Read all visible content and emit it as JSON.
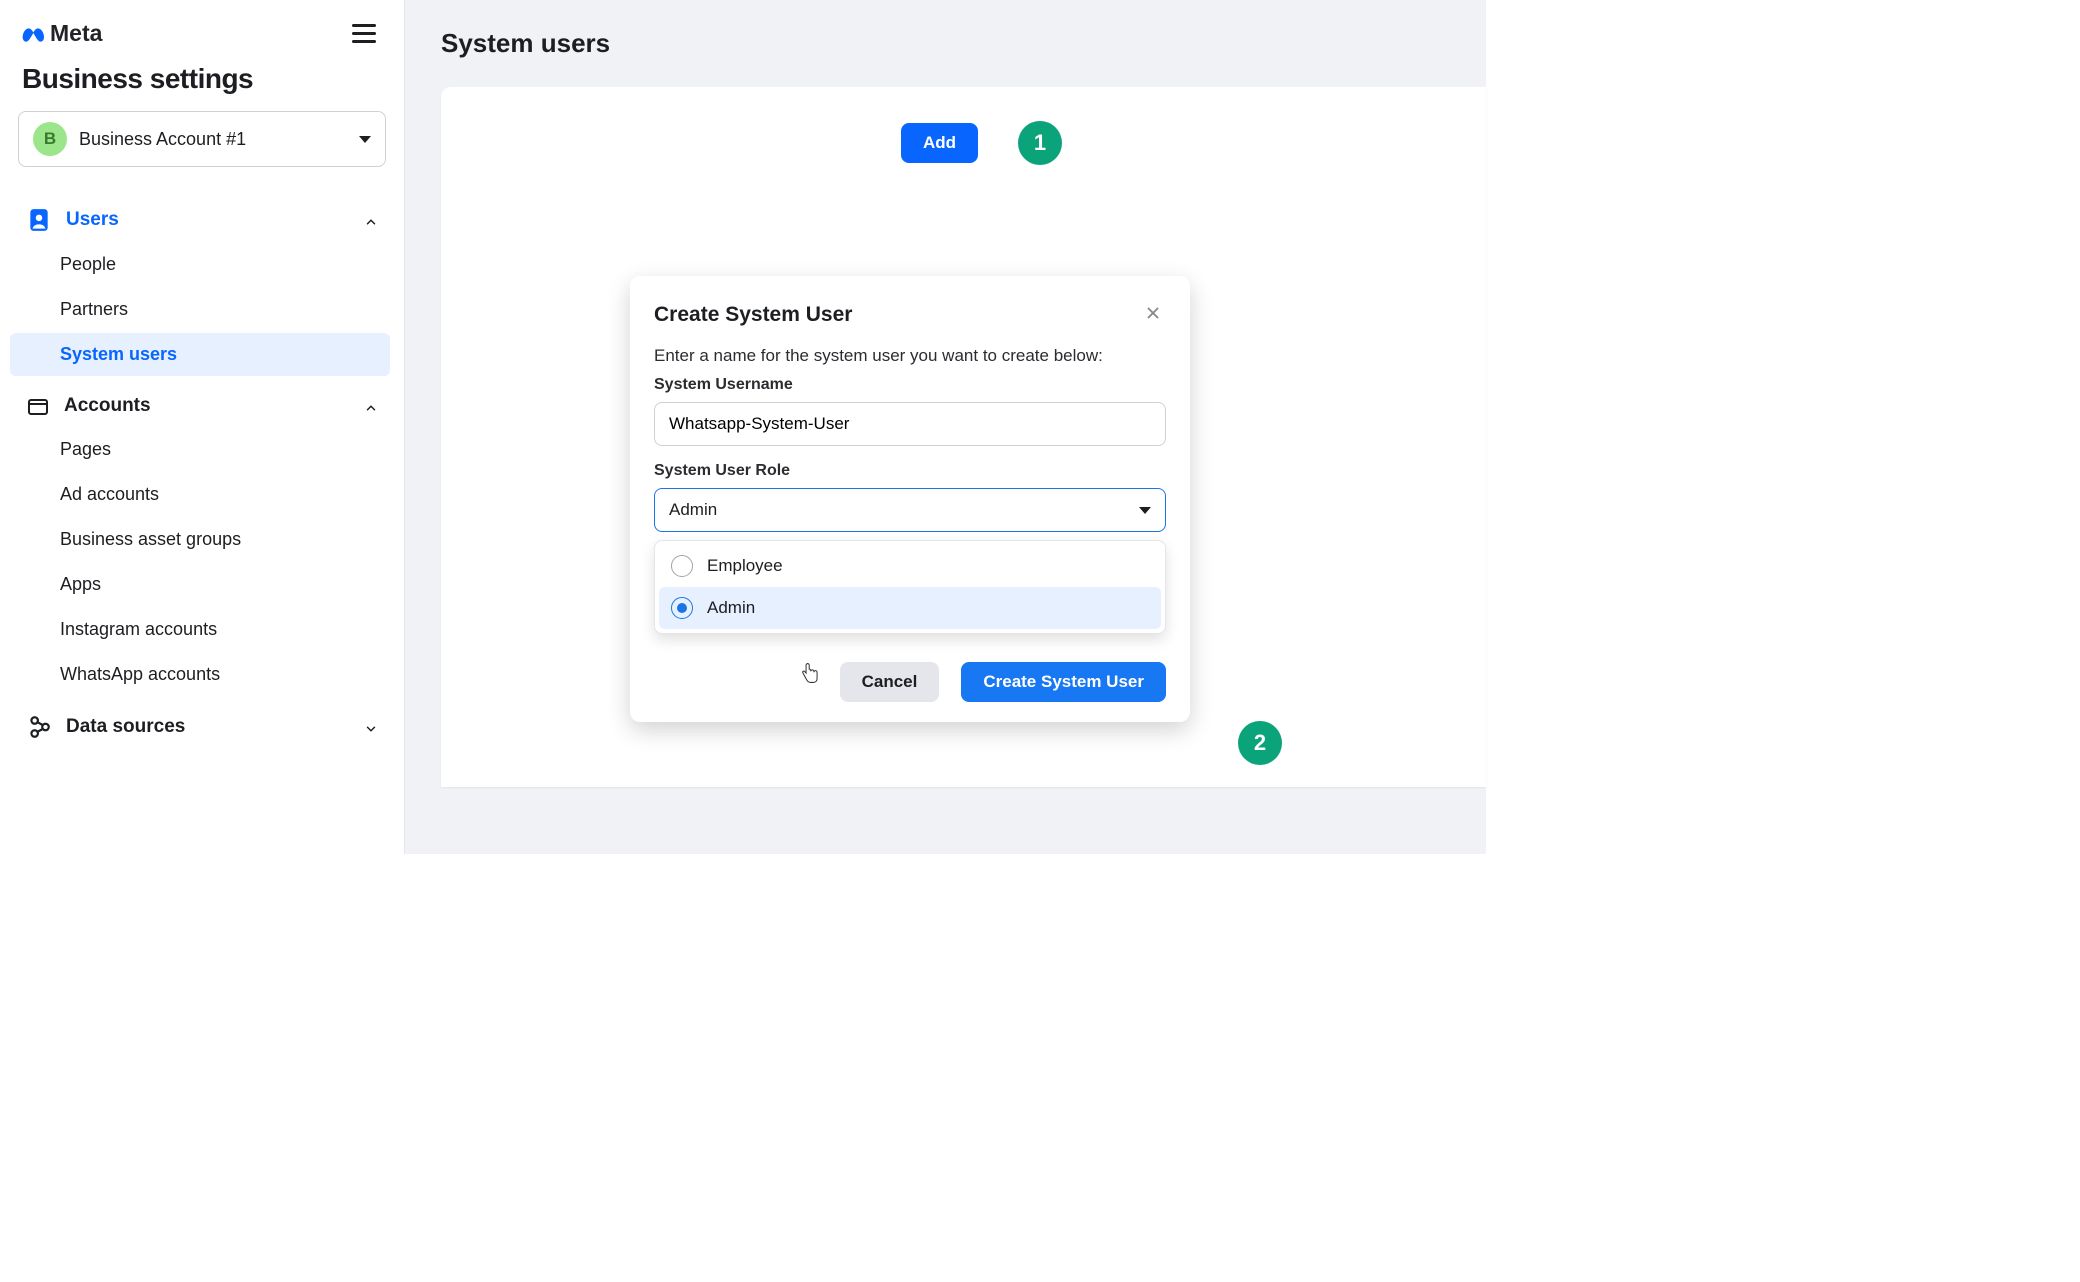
{
  "brand": {
    "name": "Meta"
  },
  "sidebar_title": "Business settings",
  "account": {
    "initial": "B",
    "name": "Business Account #1"
  },
  "nav": {
    "users": {
      "label": "Users",
      "items": [
        "People",
        "Partners",
        "System users"
      ],
      "selected": "System users"
    },
    "accounts": {
      "label": "Accounts",
      "items": [
        "Pages",
        "Ad accounts",
        "Business asset groups",
        "Apps",
        "Instagram accounts",
        "WhatsApp accounts"
      ]
    },
    "data_sources": {
      "label": "Data sources"
    }
  },
  "page": {
    "title": "System users",
    "add_label": "Add"
  },
  "steps": {
    "one": "1",
    "two": "2"
  },
  "dialog": {
    "title": "Create System User",
    "intro": "Enter a name for the system user you want to create below:",
    "username_label": "System Username",
    "username_value": "Whatsapp-System-User",
    "role_label": "System User Role",
    "role_value": "Admin",
    "options": [
      "Employee",
      "Admin"
    ],
    "selected_option": "Admin",
    "cancel": "Cancel",
    "create": "Create System User"
  }
}
